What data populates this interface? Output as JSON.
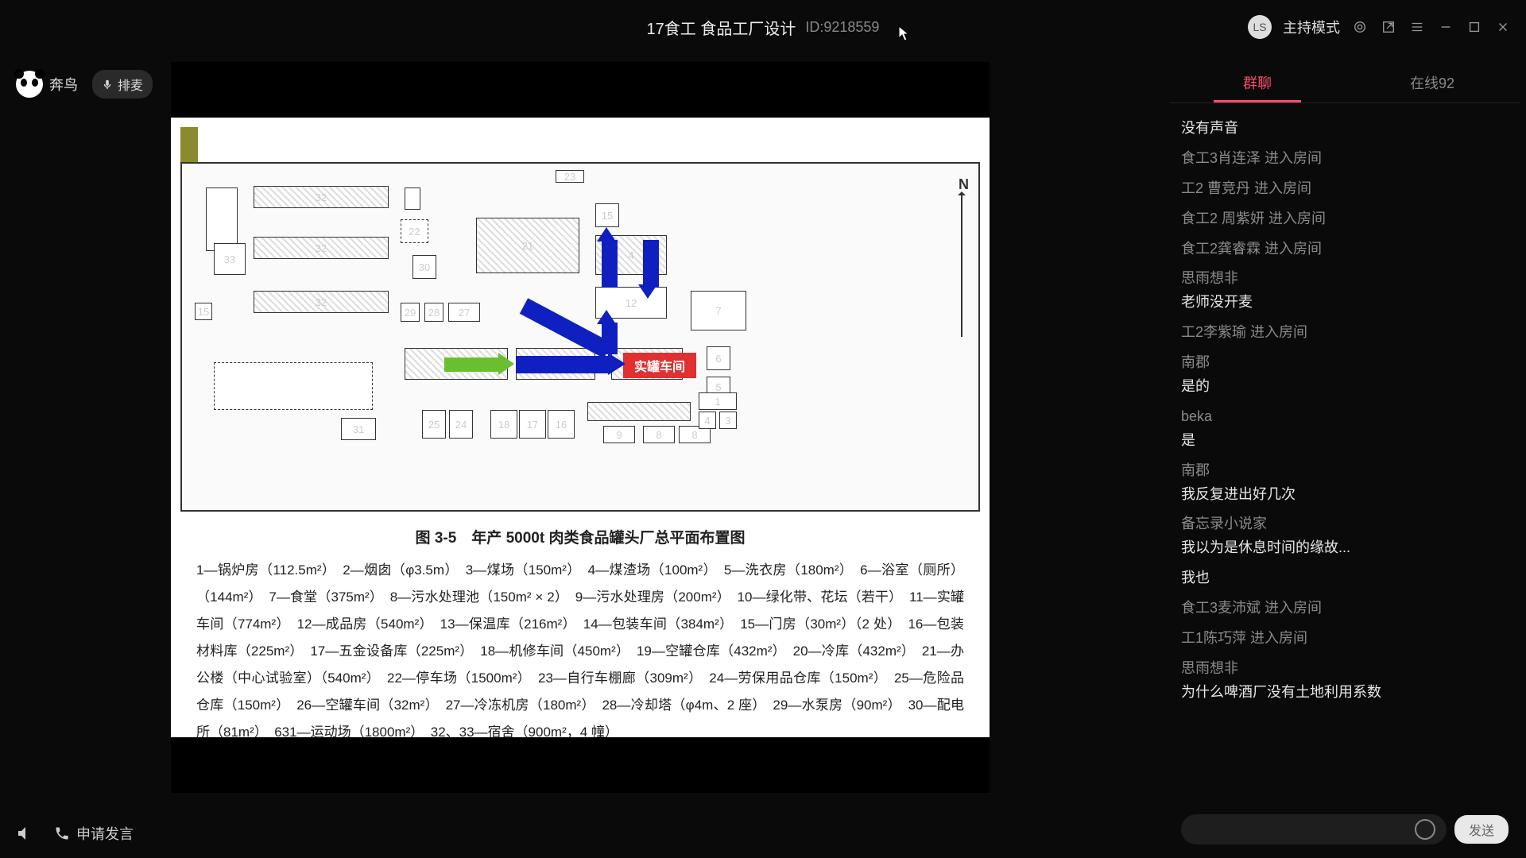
{
  "titlebar": {
    "title": "17食工  食品工厂设计",
    "id": "ID:9218559",
    "host_mode": "主持模式",
    "avatar_initials": "LS"
  },
  "top_left": {
    "panda_label": "奔鸟",
    "mic_label": "排麦"
  },
  "slide": {
    "caption": "图 3-5　年产 5000t 肉类食品罐头厂总平面布置图",
    "red_label": "实罐车间",
    "compass": "N",
    "legend": "1—锅炉房（112.5m²）　2—烟囱（φ3.5m）　3—煤场（150m²）　4—煤渣场（100m²）　5—洗衣房（180m²）　6—浴室（厕所）（144m²）　7—食堂（375m²）　8—污水处理池（150m² × 2）　9—污水处理房（200m²）　10—绿化带、花坛（若干）　11—实罐车间（774m²）　12—成品房（540m²）　13—保温库（216m²）　14—包装车间（384m²）　15—门房（30m²）（2 处）　16—包装材料库（225m²）　17—五金设备库（225m²）　18—机修车间（450m²）　19—空罐仓库（432m²）　20—冷库（432m²）　21—办公楼（中心试验室）（540m²）　22—停车场（1500m²）　23—自行车棚廊（309m²）　24—劳保用品仓库（150m²）　25—危险品仓库（150m²）　26—空罐车间（32m²）　27—冷冻机房（180m²）　28—冷却塔（φ4m、2 座）　29—水泵房（90m²）　30—配电所（81m²）　631—运动场（1800m²）　32、33—宿舍（900m²，4 幢）"
  },
  "chat": {
    "tabs": {
      "group": "群聊",
      "online": "在线92"
    },
    "messages": [
      {
        "type": "text",
        "user": "",
        "text": "没有声音"
      },
      {
        "type": "system",
        "text": "食工3肖连泽 进入房间"
      },
      {
        "type": "system",
        "text": "工2 曹竞丹 进入房间"
      },
      {
        "type": "system",
        "text": "食工2 周紫妍 进入房间"
      },
      {
        "type": "system",
        "text": "食工2龚睿霖 进入房间"
      },
      {
        "type": "text",
        "user": "思雨想非",
        "text": "老师没开麦"
      },
      {
        "type": "system",
        "text": "工2李紫瑜 进入房间"
      },
      {
        "type": "text",
        "user": "南郡",
        "text": "是的"
      },
      {
        "type": "text",
        "user": "beka",
        "text": "是"
      },
      {
        "type": "text",
        "user": "南郡",
        "text": "我反复进出好几次"
      },
      {
        "type": "text",
        "user": "备忘录小说家",
        "text": "我以为是休息时间的缘故..."
      },
      {
        "type": "text",
        "user": "",
        "text": "我也"
      },
      {
        "type": "system",
        "text": "食工3麦沛斌 进入房间"
      },
      {
        "type": "system",
        "text": "工1陈巧萍 进入房间"
      },
      {
        "type": "text",
        "user": "思雨想非",
        "text": "为什么啤酒厂没有土地利用系数"
      }
    ],
    "send_label": "发送"
  },
  "bottom": {
    "request_speak": "申请发言"
  }
}
